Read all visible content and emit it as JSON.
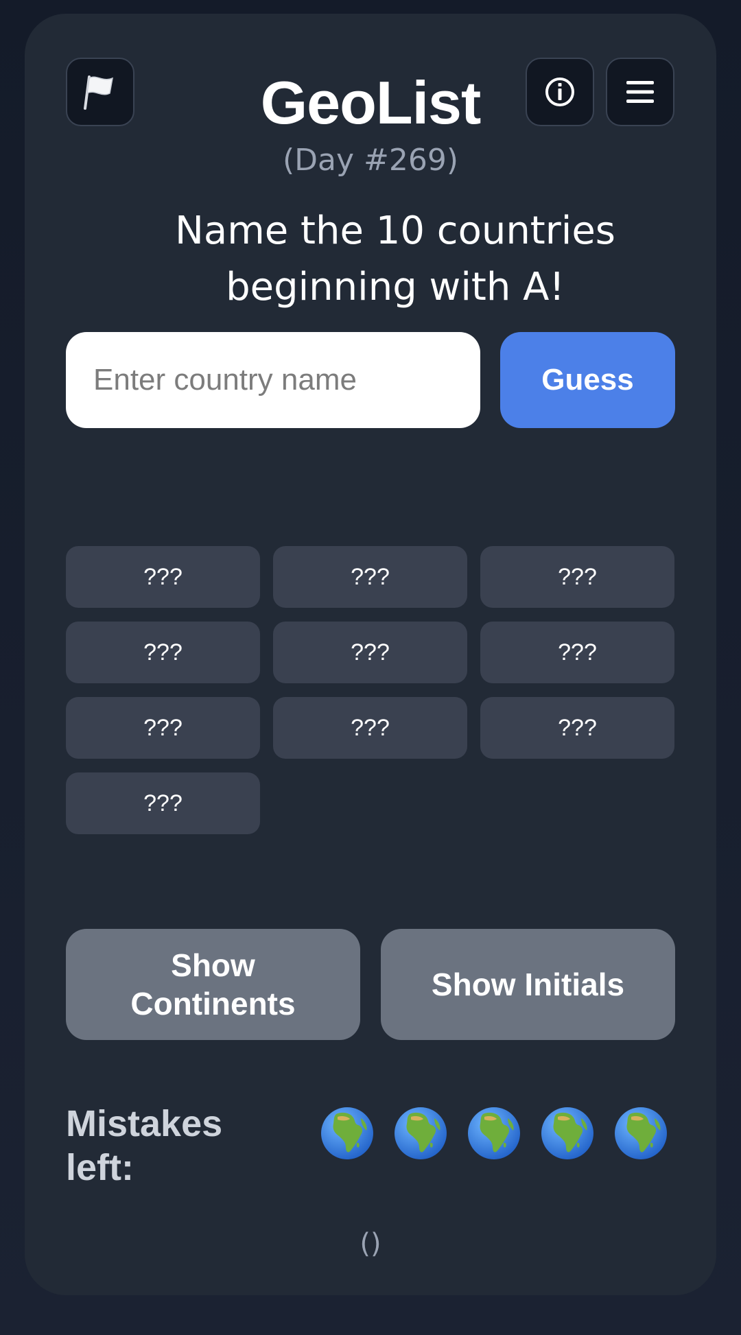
{
  "header": {
    "title": "GeoList",
    "day": "(Day #269)",
    "flag_icon": "white-flag-icon",
    "info_icon": "info-circle-icon",
    "menu_icon": "hamburger-menu-icon"
  },
  "prompt": "Name the 10 countries beginning with A!",
  "guess": {
    "input_value": "",
    "placeholder": "Enter country name",
    "button_label": "Guess"
  },
  "answers": [
    "???",
    "???",
    "???",
    "???",
    "???",
    "???",
    "???",
    "???",
    "???",
    "???"
  ],
  "hints": {
    "continents_label": "Show Continents",
    "initials_label": "Show Initials"
  },
  "mistakes": {
    "label": "Mistakes left:",
    "remaining": 5,
    "icon": "globe-africa-icon"
  },
  "footer": {
    "text": "()"
  },
  "colors": {
    "accent": "#4c80e8",
    "card": "#222a36",
    "slot": "#3a4150",
    "hint_button": "#6b7380"
  }
}
